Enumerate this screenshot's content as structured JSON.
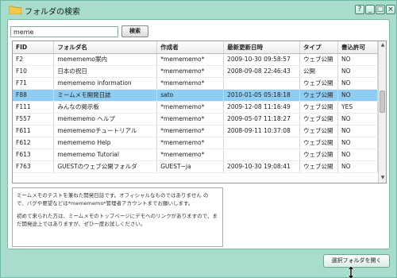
{
  "window": {
    "title": "フォルダの検索",
    "help_label": "?",
    "minimize_label": "_",
    "maximize_label": "□",
    "close_label": "×"
  },
  "search": {
    "value": "meme",
    "button_label": "検索"
  },
  "table": {
    "columns": [
      "FID",
      "フォルダ名",
      "作成者",
      "最新更新日時",
      "タイプ",
      "書込許可"
    ],
    "rows": [
      [
        "F2",
        "memememo案内",
        "*memememo*",
        "2009-10-30 09:58:57",
        "ウェブ公開",
        "NO"
      ],
      [
        "F10",
        "日本の祝日",
        "*memememo*",
        "2008-09-08 22:46:43",
        "公開",
        "NO"
      ],
      [
        "F71",
        "memememo information",
        "*memememo*",
        "",
        "ウェブ公開",
        "NO"
      ],
      [
        "F88",
        "ミームメモ開発日誌",
        "sato",
        "2010-01-05 05:18:18",
        "ウェブ公開",
        "NO"
      ],
      [
        "F111",
        "みんなの掲示板",
        "*memememo*",
        "2009-12-08 11:16:49",
        "ウェブ公開",
        "YES"
      ],
      [
        "F557",
        "memememo ヘルプ",
        "*memememo*",
        "2009-05-07 11:18:27",
        "ウェブ公開",
        "NO"
      ],
      [
        "F611",
        "memememoチュートリアル",
        "*memememo*",
        "2008-09-11 10:37:08",
        "ウェブ公開",
        "NO"
      ],
      [
        "F612",
        "memememo Help",
        "*memememo*",
        "",
        "ウェブ公開",
        "NO"
      ],
      [
        "F613",
        "memememo Tutorial",
        "*memememo*",
        "",
        "ウェブ公開",
        "NO"
      ],
      [
        "F763",
        "GUESTのウェブ公開フォルダ",
        "GUEST~ja",
        "2009-10-30 19:08:41",
        "ウェブ公開",
        "NO"
      ]
    ],
    "selected_row": 3
  },
  "description": {
    "line1": "ミームメモのテストを兼ねた開発日誌です。オフィシャルなものではありません ので、バグや要望などは*memememo*管理者アカウントまでお願いします。",
    "line2": "初めて来られた方は、ミームメモのトップページにデモへのリンクがありますので、まだ開発途上ではありますが、ぜひ一度お試しください。"
  },
  "footer": {
    "open_button_label": "選択フォルダを開く"
  }
}
